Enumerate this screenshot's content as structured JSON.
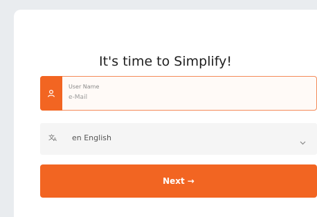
{
  "heading": "It's time to Simplify!",
  "login": {
    "label": "User Name",
    "placeholder": "e-Mail",
    "icon": "user-icon"
  },
  "language": {
    "icon": "translate-icon",
    "value": "en English",
    "chevron": "chevron-down-icon"
  },
  "next_button": {
    "label": "Next",
    "arrow": "→"
  },
  "colors": {
    "accent": "#f26522",
    "border": "#f48a58"
  }
}
